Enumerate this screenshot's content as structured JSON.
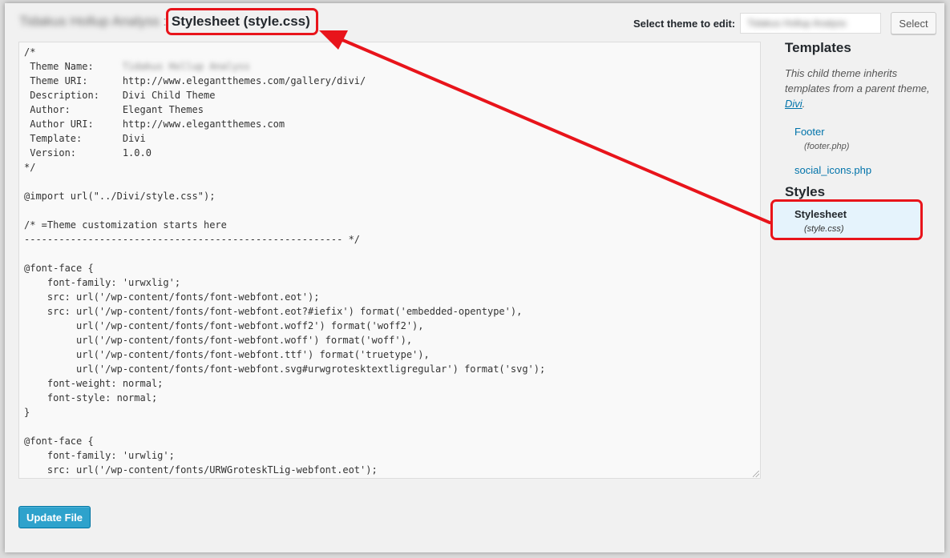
{
  "header": {
    "theme_name_blurred": "Tidakus Hollup Analyss",
    "separator": ":",
    "file_title": "Stylesheet (style.css)"
  },
  "theme_selector": {
    "label": "Select theme to edit:",
    "selected_value": "Tidakus Hollup Analyss",
    "button_label": "Select"
  },
  "editor": {
    "lines": [
      "/*",
      " Theme Name:     ",
      " Theme URI:      http://www.elegantthemes.com/gallery/divi/",
      " Description:    Divi Child Theme",
      " Author:         Elegant Themes",
      " Author URI:     http://www.elegantthemes.com",
      " Template:       Divi",
      " Version:        1.0.0",
      "*/",
      "",
      "@import url(\"../Divi/style.css\");",
      "",
      "/* =Theme customization starts here",
      "------------------------------------------------------- */",
      "",
      "@font-face {",
      "    font-family: 'urwxlig';",
      "    src: url('/wp-content/fonts/font-webfont.eot');",
      "    src: url('/wp-content/fonts/font-webfont.eot?#iefix') format('embedded-opentype'),",
      "         url('/wp-content/fonts/font-webfont.woff2') format('woff2'),",
      "         url('/wp-content/fonts/font-webfont.woff') format('woff'),",
      "         url('/wp-content/fonts/font-webfont.ttf') format('truetype'),",
      "         url('/wp-content/fonts/font-webfont.svg#urwgrotesktextligregular') format('svg');",
      "    font-weight: normal;",
      "    font-style: normal;",
      "}",
      "",
      "@font-face {",
      "    font-family: 'urwlig';",
      "    src: url('/wp-content/fonts/URWGroteskTLig-webfont.eot');"
    ],
    "theme_name_value_blurred": "Tidakus Hollup Analyss"
  },
  "sidebar": {
    "templates_heading": "Templates",
    "description_prefix": "This child theme inherits templates from a parent theme, ",
    "parent_theme_link": "Divi",
    "description_suffix": ".",
    "templates": [
      {
        "label": "Footer",
        "file": "(footer.php)"
      },
      {
        "label": "social_icons.php",
        "file": ""
      }
    ],
    "styles_heading": "Styles",
    "styles": [
      {
        "label": "Stylesheet",
        "file": "(style.css)"
      }
    ]
  },
  "footer": {
    "update_button_label": "Update File"
  },
  "colors": {
    "accent_link": "#0073aa",
    "primary_button": "#2ea2cc",
    "callout_red": "#e8141b",
    "selected_item_bg": "#e5f3fc"
  }
}
